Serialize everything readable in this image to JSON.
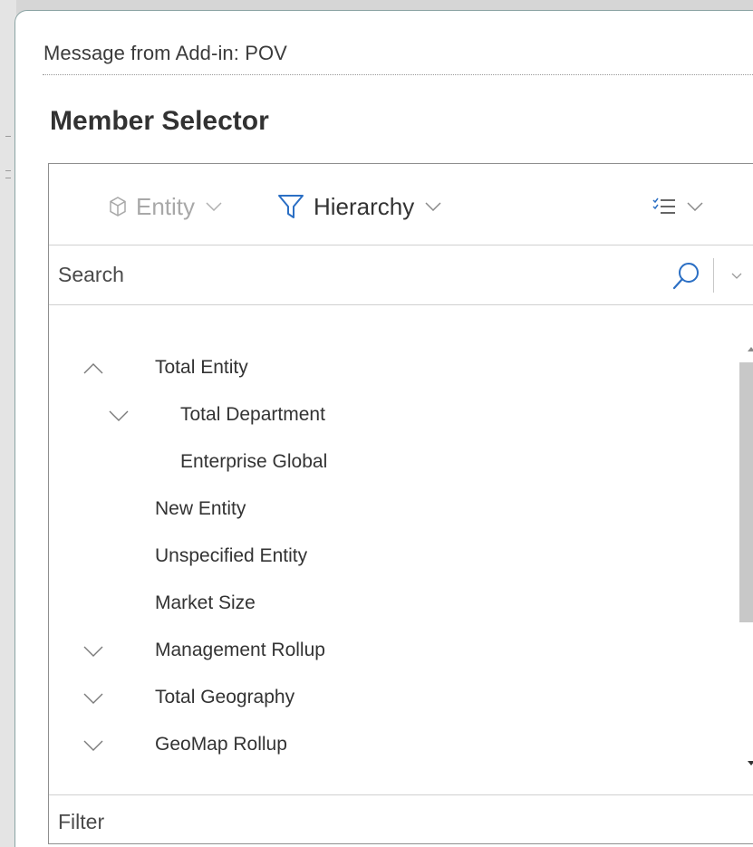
{
  "dialog": {
    "title": "Message from Add-in: POV",
    "heading": "Member Selector"
  },
  "toolbar": {
    "dimension_label": "Entity",
    "dimension_icon": "cube-icon",
    "filter_label": "Hierarchy",
    "filter_icon": "funnel-icon",
    "view_icon": "checklist-icon",
    "accent_color": "#2b6fc4",
    "disabled_color": "#a8a8a8"
  },
  "search": {
    "placeholder": "Search",
    "value": ""
  },
  "tree": {
    "items": [
      {
        "label": "Total Entity",
        "level": 0,
        "expander": "chevron-up"
      },
      {
        "label": "Total Department",
        "level": 1,
        "expander": "chevron-down"
      },
      {
        "label": "Enterprise Global",
        "level": 1,
        "expander": "none"
      },
      {
        "label": "New Entity",
        "level": 0,
        "expander": "none"
      },
      {
        "label": "Unspecified Entity",
        "level": 0,
        "expander": "none"
      },
      {
        "label": "Market Size",
        "level": 0,
        "expander": "none"
      },
      {
        "label": "Management Rollup",
        "level": 0,
        "expander": "chevron-down"
      },
      {
        "label": "Total Geography",
        "level": 0,
        "expander": "chevron-down"
      },
      {
        "label": "GeoMap Rollup",
        "level": 0,
        "expander": "chevron-down"
      }
    ]
  },
  "filter": {
    "placeholder": "Filter",
    "value": ""
  }
}
